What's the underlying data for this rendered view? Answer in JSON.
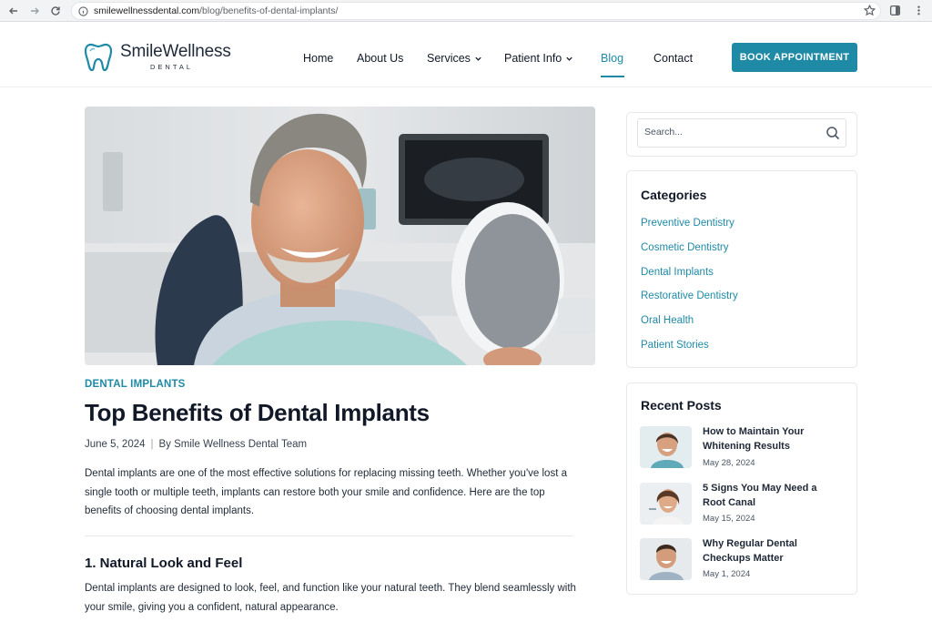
{
  "browser": {
    "url_host": "smilewellnessdental.com",
    "url_path": "/blog/benefits-of-dental-implants/"
  },
  "header": {
    "logo_name": "SmileWellness",
    "logo_sub": "DENTAL",
    "nav": [
      {
        "label": "Home"
      },
      {
        "label": "About Us"
      },
      {
        "label": "Services",
        "has_dropdown": true
      },
      {
        "label": "Patient Info",
        "has_dropdown": true
      },
      {
        "label": "Blog",
        "active": true
      },
      {
        "label": "Contact"
      }
    ],
    "cta_label": "BOOK APPOINTMENT",
    "accent_color": "#1f8aa6"
  },
  "article": {
    "category": "DENTAL IMPLANTS",
    "title": "Top Benefits of Dental Implants",
    "date": "June 5, 2024",
    "author": "By Smile Wellness Dental Team",
    "intro": "Dental implants are one of the most effective solutions for replacing missing teeth. Whether you've lost a single tooth or multiple teeth, implants can restore both your smile and confidence. Here are the top benefits of choosing dental implants.",
    "section_heading": "1. Natural Look and Feel",
    "section_body": "Dental implants are designed to look, feel, and function like your natural teeth. They blend seamlessly with your smile, giving you a confident, natural appearance."
  },
  "sidebar": {
    "search_placeholder": "Search...",
    "categories_title": "Categories",
    "categories": [
      "Preventive Dentistry",
      "Cosmetic Dentistry",
      "Dental Implants",
      "Restorative Dentistry",
      "Oral Health",
      "Patient Stories"
    ],
    "recent_title": "Recent Posts",
    "recent_posts": [
      {
        "title": "How to Maintain Your Whitening Results",
        "date": "May 28, 2024"
      },
      {
        "title": "5 Signs You May Need a Root Canal",
        "date": "May 15, 2024"
      },
      {
        "title": "Why Regular Dental Checkups Matter",
        "date": "May 1, 2024"
      }
    ]
  }
}
